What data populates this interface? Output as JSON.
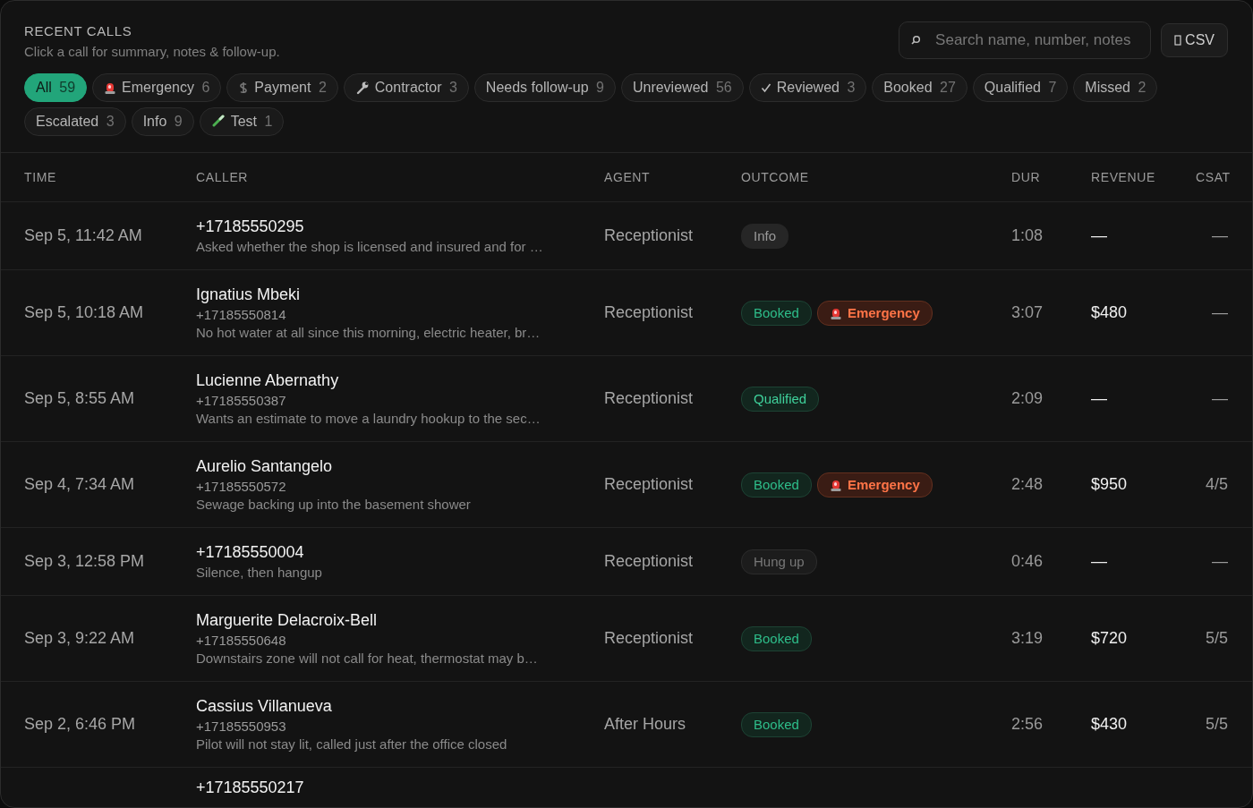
{
  "header": {
    "title": "RECENT CALLS",
    "subtitle": "Click a call for summary, notes & follow-up."
  },
  "search": {
    "placeholder": "Search name, number, notes"
  },
  "export_button": {
    "label": "CSV"
  },
  "filters": [
    {
      "label": "All",
      "count": "59",
      "selected": true
    },
    {
      "label": "Emergency",
      "count": "6",
      "kind": "siren",
      "selected": false
    },
    {
      "label": "Payment",
      "count": "2",
      "kind": "dollar",
      "selected": false
    },
    {
      "label": "Contractor",
      "count": "3",
      "kind": "wrench",
      "selected": false
    },
    {
      "label": "Needs follow-up",
      "count": "9",
      "selected": false
    },
    {
      "label": "Unreviewed",
      "count": "56",
      "selected": false
    },
    {
      "label": "Reviewed",
      "count": "3",
      "kind": "check",
      "selected": false
    },
    {
      "label": "Booked",
      "count": "27",
      "selected": false
    },
    {
      "label": "Qualified",
      "count": "7",
      "selected": false
    },
    {
      "label": "Missed",
      "count": "2",
      "selected": false
    },
    {
      "label": "Escalated",
      "count": "3",
      "selected": false
    },
    {
      "label": "Info",
      "count": "9",
      "selected": false
    },
    {
      "label": "Test",
      "count": "1",
      "kind": "testtube",
      "selected": false
    }
  ],
  "table": {
    "columns": [
      "TIME",
      "CALLER",
      "AGENT",
      "OUTCOME",
      "DUR",
      "REVENUE",
      "CSAT"
    ],
    "rows": [
      {
        "time": "Sep 5, 11:42 AM",
        "caller": "+17185550295",
        "summary": "Asked whether the shop is licensed and insured and for …",
        "agent": "Receptionist",
        "tags": [
          {
            "kind": "info",
            "label": "Info"
          }
        ],
        "duration": "1:08",
        "revenue": "—",
        "csat": "—"
      },
      {
        "time": "Sep 5, 10:18 AM",
        "caller": "Ignatius Mbeki",
        "number": "+17185550814",
        "summary": "No hot water at all since this morning, electric heater, br…",
        "agent": "Receptionist",
        "tags": [
          {
            "kind": "booked",
            "label": "Booked"
          },
          {
            "kind": "emergency",
            "label": "Emergency"
          }
        ],
        "duration": "3:07",
        "revenue": "$480",
        "csat": "—"
      },
      {
        "time": "Sep 5, 8:55 AM",
        "caller": "Lucienne Abernathy",
        "number": "+17185550387",
        "summary": "Wants an estimate to move a laundry hookup to the sec…",
        "agent": "Receptionist",
        "tags": [
          {
            "kind": "qualified",
            "label": "Qualified"
          }
        ],
        "duration": "2:09",
        "revenue": "—",
        "csat": "—"
      },
      {
        "time": "Sep 4, 7:34 AM",
        "caller": "Aurelio Santangelo",
        "number": "+17185550572",
        "summary": "Sewage backing up into the basement shower",
        "agent": "Receptionist",
        "tags": [
          {
            "kind": "booked",
            "label": "Booked"
          },
          {
            "kind": "emergency",
            "label": "Emergency"
          }
        ],
        "duration": "2:48",
        "revenue": "$950",
        "csat": "4/5"
      },
      {
        "time": "Sep 3, 12:58 PM",
        "caller": "+17185550004",
        "summary": "Silence, then hangup",
        "agent": "Receptionist",
        "tags": [
          {
            "kind": "hungup",
            "label": "Hung up"
          }
        ],
        "duration": "0:46",
        "revenue": "—",
        "csat": "—"
      },
      {
        "time": "Sep 3, 9:22 AM",
        "caller": "Marguerite Delacroix-Bell",
        "number": "+17185550648",
        "summary": "Downstairs zone will not call for heat, thermostat may b…",
        "agent": "Receptionist",
        "tags": [
          {
            "kind": "booked",
            "label": "Booked"
          }
        ],
        "duration": "3:19",
        "revenue": "$720",
        "csat": "5/5"
      },
      {
        "time": "Sep 2, 6:46 PM",
        "caller": "Cassius Villanueva",
        "number": "+17185550953",
        "summary": "Pilot will not stay lit, called just after the office closed",
        "agent": "After Hours",
        "tags": [
          {
            "kind": "booked",
            "label": "Booked"
          }
        ],
        "duration": "2:56",
        "revenue": "$430",
        "csat": "5/5"
      },
      {
        "caller": "+17185550217"
      }
    ]
  }
}
